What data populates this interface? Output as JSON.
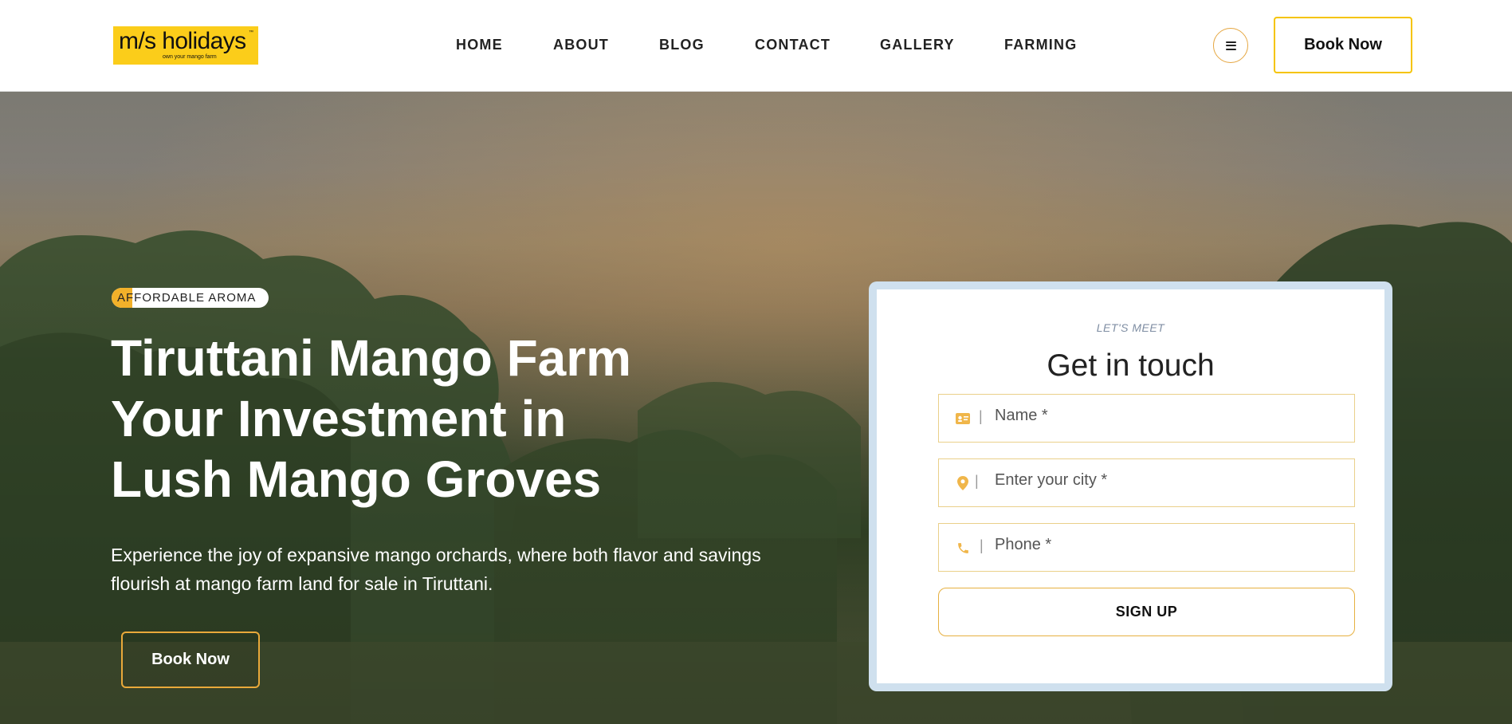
{
  "header": {
    "logo": {
      "main": "m/s holidays",
      "tm": "™",
      "tagline": "own your mango farm"
    },
    "nav": [
      {
        "label": "HOME"
      },
      {
        "label": "ABOUT"
      },
      {
        "label": "BLOG"
      },
      {
        "label": "CONTACT"
      },
      {
        "label": "GALLERY"
      },
      {
        "label": "FARMING"
      }
    ],
    "menu_icon": "hamburger-icon",
    "book_label": "Book Now"
  },
  "hero": {
    "tag": "AFFORDABLE AROMA",
    "title_lines": [
      "Tiruttani Mango Farm",
      "Your Investment in",
      "Lush Mango Groves"
    ],
    "description": "Experience the joy of expansive mango orchards, where both flavor and savings flourish at mango farm land for sale in Tiruttani.",
    "book_label": "Book Now"
  },
  "form": {
    "eyebrow": "LET'S MEET",
    "title": "Get in touch",
    "fields": [
      {
        "placeholder": "Name *",
        "icon": "id-card-icon"
      },
      {
        "placeholder": "Enter your city *",
        "icon": "location-pin-icon"
      },
      {
        "placeholder": "Phone *",
        "icon": "phone-icon"
      }
    ],
    "submit_label": "SIGN UP"
  },
  "colors": {
    "brand_yellow": "#fbcd1a",
    "accent_orange": "#e9a93a",
    "card_frame": "#cfe0ee"
  }
}
